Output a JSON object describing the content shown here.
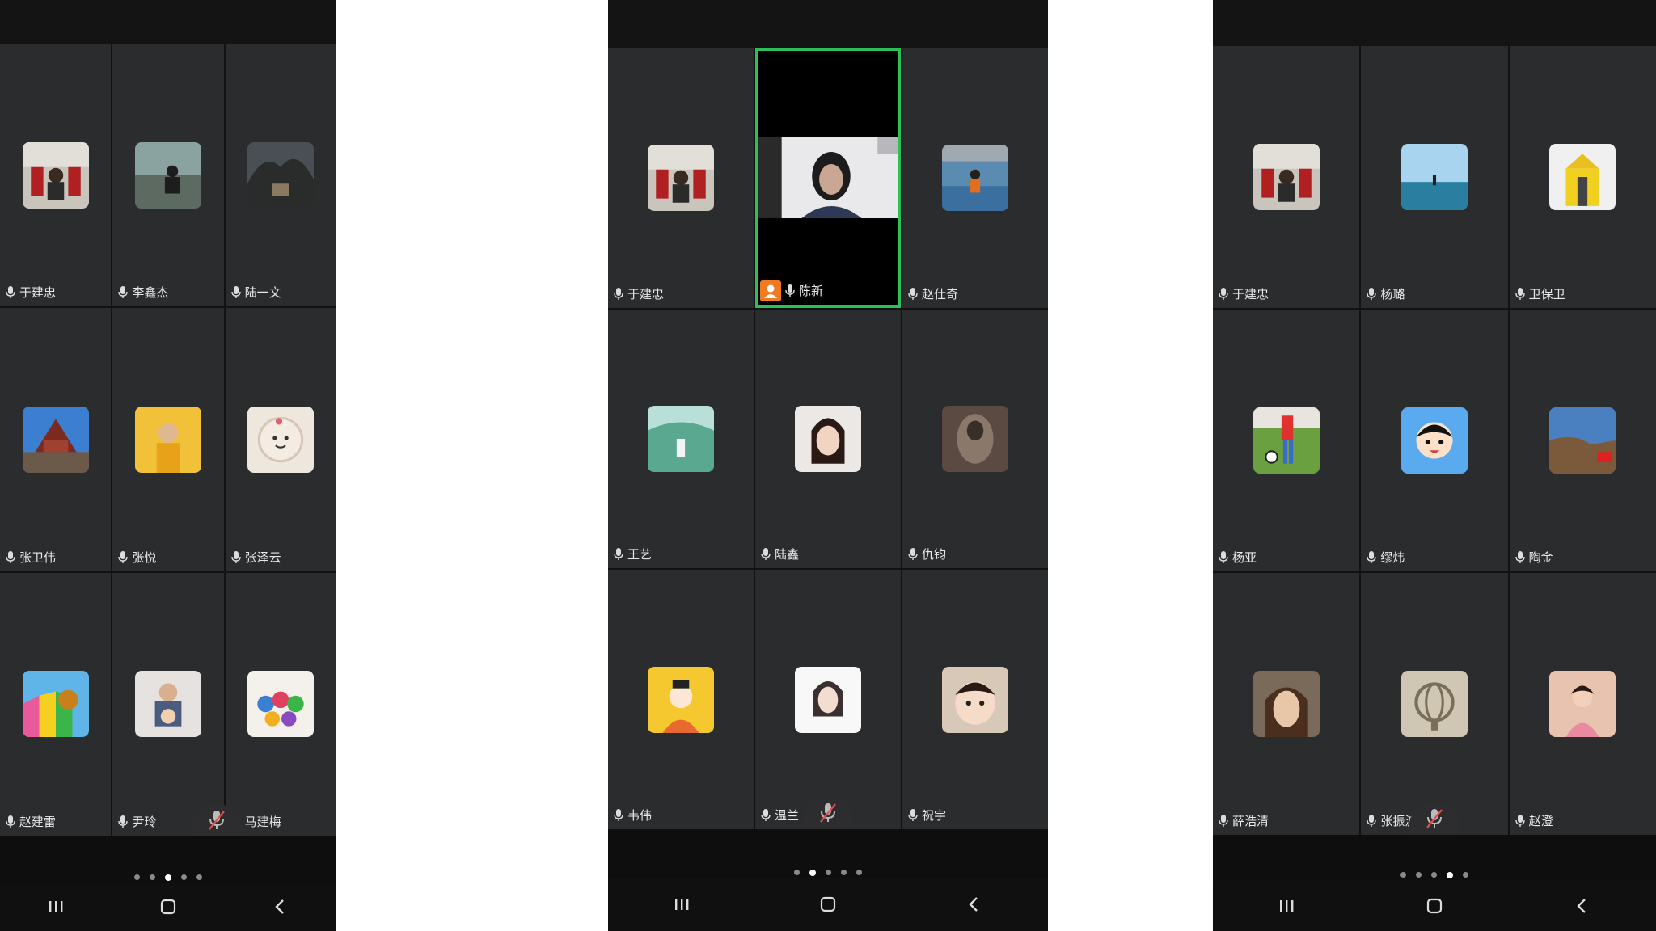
{
  "screens": [
    {
      "tiles": [
        {
          "name": "于建忠"
        },
        {
          "name": "李鑫杰"
        },
        {
          "name": "陆一文"
        },
        {
          "name": "张卫伟"
        },
        {
          "name": "张悦"
        },
        {
          "name": "张泽云"
        },
        {
          "name": "赵建雷"
        },
        {
          "name": "尹玲"
        },
        {
          "name": "马建梅"
        }
      ],
      "page_dots": 5,
      "active_dot": 3
    },
    {
      "tiles": [
        {
          "name": "于建忠"
        },
        {
          "name": "陈新"
        },
        {
          "name": "赵仕奇"
        },
        {
          "name": "王艺"
        },
        {
          "name": "陆鑫"
        },
        {
          "name": "仇钧"
        },
        {
          "name": "韦伟"
        },
        {
          "name": "温兰"
        },
        {
          "name": "祝宇"
        }
      ],
      "page_dots": 5,
      "active_dot": 2
    },
    {
      "tiles": [
        {
          "name": "于建忠"
        },
        {
          "name": "杨璐"
        },
        {
          "name": "卫保卫"
        },
        {
          "name": "杨亚"
        },
        {
          "name": "缪炜"
        },
        {
          "name": "陶金"
        },
        {
          "name": "薛浩清"
        },
        {
          "name": "张振波"
        },
        {
          "name": "赵澄"
        }
      ],
      "page_dots": 5,
      "active_dot": 4
    }
  ],
  "colors": {
    "active_speaker_border": "#2fbf5a",
    "host_badge": "#f07a22",
    "tile_background": "#2b2c2e"
  },
  "icons": {
    "mic": "mic-icon",
    "muted_mic": "mic-off-icon",
    "host": "host-badge-icon",
    "recent_apps": "recent-apps-icon",
    "home": "home-icon",
    "back": "back-icon"
  }
}
